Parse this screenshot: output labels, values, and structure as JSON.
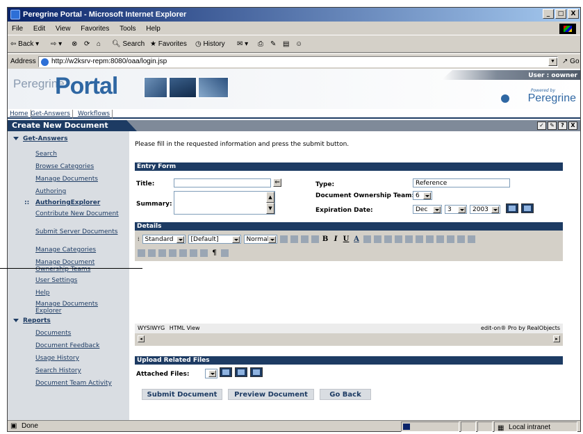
{
  "window": {
    "title": "Peregrine Portal - Microsoft Internet Explorer",
    "buttons": [
      "_",
      "□",
      "X"
    ]
  },
  "menu": [
    "File",
    "Edit",
    "View",
    "Favorites",
    "Tools",
    "Help"
  ],
  "toolbar": {
    "back": "Back",
    "search": "Search",
    "favorites": "Favorites",
    "history": "History"
  },
  "address": {
    "label": "Address",
    "url": "http://w2ksrv-repm:8080/oaa/login.jsp",
    "go": "Go"
  },
  "banner": {
    "brand_small": "Peregrine",
    "brand_big": "Portal",
    "user": "User : oowner",
    "powered_by": "Powered by",
    "logo": "Peregrine"
  },
  "nav": [
    "Home",
    "Get-Answers",
    "Workflows"
  ],
  "section_title": "Create New Document",
  "section_icons": [
    "✓",
    "✎",
    "?",
    "X"
  ],
  "sidebar": {
    "group1": "Get-Answers",
    "items1": [
      "Search",
      "Browse Categories",
      "Manage Documents",
      "Authoring"
    ],
    "sub_head": "AuthoringExplorer",
    "items2": [
      "Contribute New Document",
      "Submit Server Documents",
      "Manage Categories",
      "Manage Document Ownership Teams",
      "User Settings",
      "Help",
      "Manage Documents Explorer"
    ],
    "group2": "Reports",
    "items3": [
      "Documents",
      "Document Feedback",
      "Usage History",
      "Search History",
      "Document Team Activity"
    ]
  },
  "main": {
    "instructions": "Please fill in the requested information and press the submit button.",
    "entry_form": "Entry Form",
    "title_label": "Title:",
    "summary_label": "Summary:",
    "type_label": "Type:",
    "type_value": "Reference",
    "team_label": "Document Ownership Team:",
    "team_value": "6",
    "expiration_label": "Expiration Date:",
    "exp_month": "Dec",
    "exp_day": "3",
    "exp_year": "2003",
    "details": "Details",
    "style_select": "Standard",
    "font_select": "[Default]",
    "size_select": "Normal",
    "fmt_bold": "B",
    "fmt_italic": "I",
    "fmt_underline": "U",
    "fmt_color": "A",
    "tab_wysiwyg": "WYSIWYG",
    "tab_html": "HTML View",
    "editor_credit": "edit-on® Pro by RealObjects",
    "upload": "Upload Related Files",
    "attached_label": "Attached Files:",
    "submit": "Submit Document",
    "preview": "Preview Document",
    "back": "Go Back"
  },
  "status": {
    "text": "Done",
    "zone": "Local intranet"
  }
}
